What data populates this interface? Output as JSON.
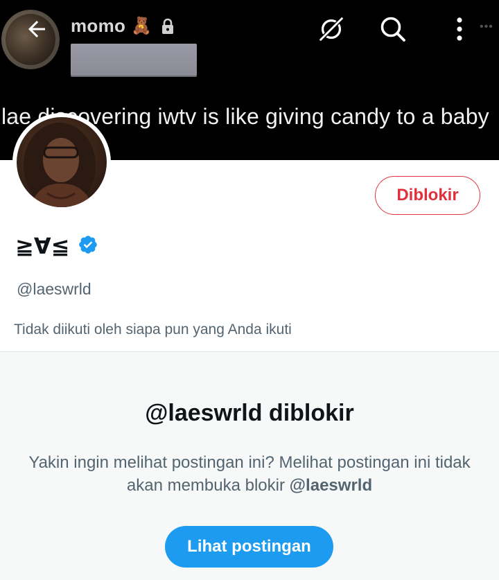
{
  "header": {
    "account_name": "momo",
    "account_emoji": "🧸",
    "back_icon": "arrow-left-icon",
    "lock_icon": "lock-icon",
    "grok_icon": "grok-icon",
    "search_icon": "search-icon",
    "more_icon": "more-vertical-icon"
  },
  "banner": {
    "caption": "lae discovering iwtv is like giving candy to a baby"
  },
  "profile": {
    "display_name": "≧∀≦",
    "verified_icon": "verified-badge-icon",
    "handle": "@laeswrld",
    "follow_info": "Tidak diikuti oleh siapa pun yang Anda ikuti",
    "blocked_button_label": "Diblokir"
  },
  "blocked_notice": {
    "title": "@laeswrld diblokir",
    "description_prefix": "Yakin ingin melihat postingan ini? Melihat postingan ini tidak akan membuka blokir ",
    "description_handle": "@laeswrld",
    "view_posts_label": "Lihat postingan"
  },
  "colors": {
    "accent": "#1d9bf0",
    "blocked_red": "#e0303c",
    "banner_bg": "#000000",
    "panel_bg": "#f7f9f9"
  }
}
